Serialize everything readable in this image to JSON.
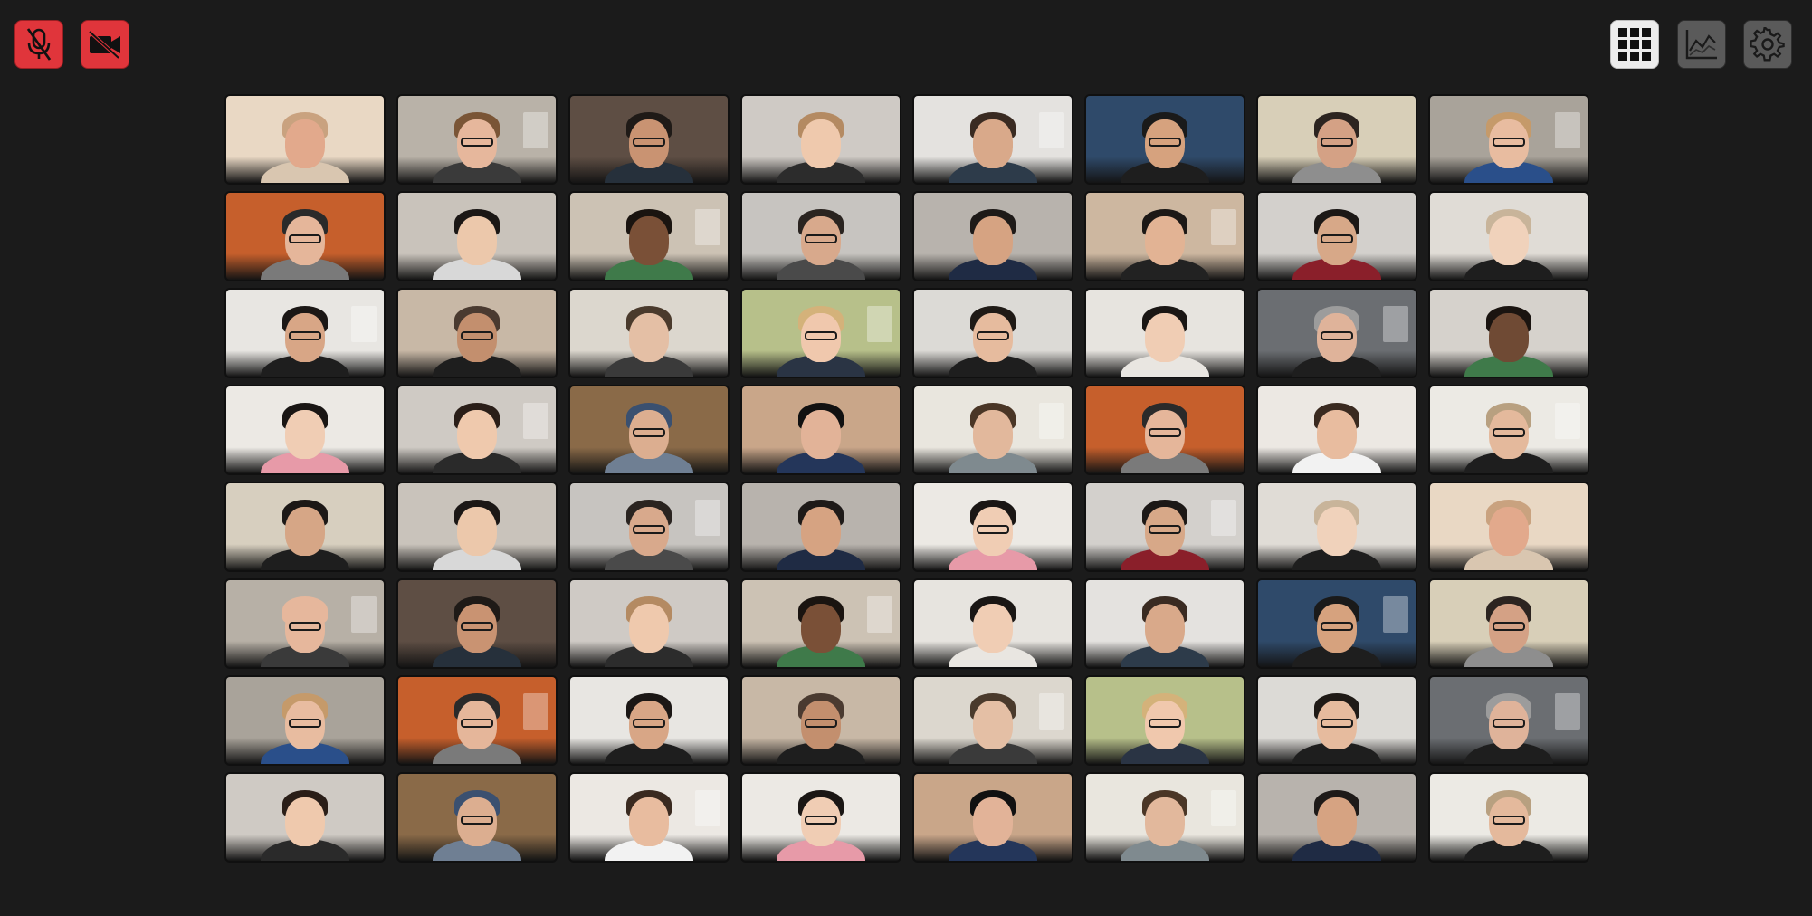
{
  "controls": {
    "mic": {
      "icon": "mic-muted-icon",
      "color": "#e0353b"
    },
    "camera": {
      "icon": "camera-off-icon",
      "color": "#e0353b"
    },
    "layout": {
      "icon": "grid-layout-icon"
    },
    "stats": {
      "icon": "stats-chart-icon"
    },
    "settings": {
      "icon": "gear-icon"
    }
  },
  "participants": [
    {
      "bg": "#e9d8c4",
      "skin": "#e2a98c",
      "hair": "#c9a27f",
      "shirt": "#d9c6b0",
      "glasses": false
    },
    {
      "bg": "#b9b2a8",
      "skin": "#e6b79c",
      "hair": "#7a5536",
      "shirt": "#3a3a3a",
      "glasses": true
    },
    {
      "bg": "#5e4e44",
      "skin": "#c99372",
      "hair": "#1f1a17",
      "shirt": "#26303b",
      "glasses": true
    },
    {
      "bg": "#cfcac5",
      "skin": "#efc9ad",
      "hair": "#b48a62",
      "shirt": "#2c2c2c",
      "glasses": false
    },
    {
      "bg": "#e4e2df",
      "skin": "#d9a98a",
      "hair": "#3a2b22",
      "shirt": "#2d3b4a",
      "glasses": false
    },
    {
      "bg": "#2f4a6a",
      "skin": "#d6a27e",
      "hair": "#1a1a1a",
      "shirt": "#1e1e1e",
      "glasses": true
    },
    {
      "bg": "#d8cfb8",
      "skin": "#d4a185",
      "hair": "#2c2420",
      "shirt": "#8e8e8e",
      "glasses": true
    },
    {
      "bg": "#a9a39a",
      "skin": "#e8bca0",
      "hair": "#c59a6a",
      "shirt": "#2a4f8a",
      "glasses": true
    },
    {
      "bg": "#c65f2c",
      "skin": "#e5b69a",
      "hair": "#2a2a2a",
      "shirt": "#7a7a7a",
      "glasses": true
    },
    {
      "bg": "#c9c3bb",
      "skin": "#ecc8ab",
      "hair": "#1b1715",
      "shirt": "#d8d8d8",
      "glasses": false
    },
    {
      "bg": "#ccc2b4",
      "skin": "#7a5037",
      "hair": "#1a1410",
      "shirt": "#3f7a4a",
      "glasses": false
    },
    {
      "bg": "#c7c4c0",
      "skin": "#d8a98c",
      "hair": "#2a2420",
      "shirt": "#4a4a4a",
      "glasses": true
    },
    {
      "bg": "#b8b3ad",
      "skin": "#d6a382",
      "hair": "#1e1a18",
      "shirt": "#1f2b44",
      "glasses": false
    },
    {
      "bg": "#cdb7a0",
      "skin": "#e2b394",
      "hair": "#1c1816",
      "shirt": "#222222",
      "glasses": false
    },
    {
      "bg": "#d3d0cc",
      "skin": "#d7a888",
      "hair": "#1c1816",
      "shirt": "#8a1f2a",
      "glasses": true
    },
    {
      "bg": "#e0dcd6",
      "skin": "#f0d2bb",
      "hair": "#c8b49a",
      "shirt": "#1e1e1e",
      "glasses": false
    },
    {
      "bg": "#e8e6e2",
      "skin": "#d8a686",
      "hair": "#1b1715",
      "shirt": "#1e1e1e",
      "glasses": true
    },
    {
      "bg": "#c8b8a6",
      "skin": "#c38f6e",
      "hair": "#4a3a30",
      "shirt": "#1e1e1e",
      "glasses": true
    },
    {
      "bg": "#dcd7ce",
      "skin": "#e4bfa5",
      "hair": "#4a3a2c",
      "shirt": "#3a3a3a",
      "glasses": false
    },
    {
      "bg": "#b7c08a",
      "skin": "#f0c8ad",
      "hair": "#d4b27a",
      "shirt": "#2a3444",
      "glasses": true
    },
    {
      "bg": "#dcdad6",
      "skin": "#e6bb9e",
      "hair": "#1f1a16",
      "shirt": "#1e1e1e",
      "glasses": true
    },
    {
      "bg": "#e7e4df",
      "skin": "#f0cdb4",
      "hair": "#1a1614",
      "shirt": "#e9e6e1",
      "glasses": false
    },
    {
      "bg": "#6b6e72",
      "skin": "#dfb39a",
      "hair": "#9c9c9c",
      "shirt": "#1e1e1e",
      "glasses": true
    },
    {
      "bg": "#d6d2cc",
      "skin": "#6f4a34",
      "hair": "#1a1410",
      "shirt": "#3f7a4a",
      "glasses": false
    },
    {
      "bg": "#ece9e4",
      "skin": "#f0cdb4",
      "hair": "#1a1614",
      "shirt": "#e79aa8",
      "glasses": false
    },
    {
      "bg": "#cfcac4",
      "skin": "#efc9ad",
      "hair": "#2a1e18",
      "shirt": "#2a2a2a",
      "glasses": false
    },
    {
      "bg": "#8a6a48",
      "skin": "#dcae90",
      "hair": "#3a5070",
      "shirt": "#6f7f93",
      "glasses": true
    },
    {
      "bg": "#c9a689",
      "skin": "#e2b398",
      "hair": "#111111",
      "shirt": "#24365a",
      "glasses": false
    },
    {
      "bg": "#e9e6de",
      "skin": "#e2b89c",
      "hair": "#4a3626",
      "shirt": "#7f8a8f",
      "glasses": false
    },
    {
      "bg": "#c65f2c",
      "skin": "#e5b69a",
      "hair": "#2a2a2a",
      "shirt": "#7a7a7a",
      "glasses": true
    },
    {
      "bg": "#ece8e3",
      "skin": "#e8bc9f",
      "hair": "#3a2a20",
      "shirt": "#f2f2f2",
      "glasses": false
    },
    {
      "bg": "#eceae4",
      "skin": "#e4b99c",
      "hair": "#b8a080",
      "shirt": "#1e1e1e",
      "glasses": true
    },
    {
      "bg": "#d7cfbf",
      "skin": "#d6a686",
      "hair": "#1c1816",
      "shirt": "#1e1e1e",
      "glasses": false
    },
    {
      "bg": "#c9c3bb",
      "skin": "#ecc8ab",
      "hair": "#1b1715",
      "shirt": "#d8d8d8",
      "glasses": false
    },
    {
      "bg": "#c7c4c0",
      "skin": "#d8a98c",
      "hair": "#2a2420",
      "shirt": "#4a4a4a",
      "glasses": true
    },
    {
      "bg": "#b8b3ad",
      "skin": "#d6a382",
      "hair": "#1e1a18",
      "shirt": "#1f2b44",
      "glasses": false
    },
    {
      "bg": "#ece9e4",
      "skin": "#f0cdb4",
      "hair": "#1a1614",
      "shirt": "#e79aa8",
      "glasses": true
    },
    {
      "bg": "#d3d0cc",
      "skin": "#d7a888",
      "hair": "#1c1816",
      "shirt": "#8a1f2a",
      "glasses": true
    },
    {
      "bg": "#e0dcd6",
      "skin": "#f0d2bb",
      "hair": "#c8b49a",
      "shirt": "#1e1e1e",
      "glasses": false
    },
    {
      "bg": "#e9d8c4",
      "skin": "#e2a98c",
      "hair": "#c9a27f",
      "shirt": "#d9c6b0",
      "glasses": false
    },
    {
      "bg": "#b7b0a6",
      "skin": "#e6b79c",
      "hair": "#e6b79c",
      "shirt": "#3a3a3a",
      "glasses": true
    },
    {
      "bg": "#5e4e44",
      "skin": "#c99372",
      "hair": "#1f1a17",
      "shirt": "#26303b",
      "glasses": true
    },
    {
      "bg": "#cfcac5",
      "skin": "#efc9ad",
      "hair": "#b48a62",
      "shirt": "#2c2c2c",
      "glasses": false
    },
    {
      "bg": "#ccc2b4",
      "skin": "#7a5037",
      "hair": "#1a1410",
      "shirt": "#3f7a4a",
      "glasses": false
    },
    {
      "bg": "#e7e4df",
      "skin": "#f0cdb4",
      "hair": "#1a1614",
      "shirt": "#e9e6e1",
      "glasses": false
    },
    {
      "bg": "#e4e2df",
      "skin": "#d9a98a",
      "hair": "#3a2b22",
      "shirt": "#2d3b4a",
      "glasses": false
    },
    {
      "bg": "#2f4a6a",
      "skin": "#d6a27e",
      "hair": "#1a1a1a",
      "shirt": "#1e1e1e",
      "glasses": true
    },
    {
      "bg": "#d8cfb8",
      "skin": "#d4a185",
      "hair": "#2c2420",
      "shirt": "#8e8e8e",
      "glasses": true
    },
    {
      "bg": "#a9a39a",
      "skin": "#e8bca0",
      "hair": "#c59a6a",
      "shirt": "#2a4f8a",
      "glasses": true
    },
    {
      "bg": "#c65f2c",
      "skin": "#e5b69a",
      "hair": "#2a2a2a",
      "shirt": "#7a7a7a",
      "glasses": true
    },
    {
      "bg": "#e8e6e2",
      "skin": "#d8a686",
      "hair": "#1b1715",
      "shirt": "#1e1e1e",
      "glasses": true
    },
    {
      "bg": "#c8b8a6",
      "skin": "#c38f6e",
      "hair": "#4a3a30",
      "shirt": "#1e1e1e",
      "glasses": true
    },
    {
      "bg": "#dcd7ce",
      "skin": "#e4bfa5",
      "hair": "#4a3a2c",
      "shirt": "#3a3a3a",
      "glasses": false
    },
    {
      "bg": "#b7c08a",
      "skin": "#f0c8ad",
      "hair": "#d4b27a",
      "shirt": "#2a3444",
      "glasses": true
    },
    {
      "bg": "#dcdad6",
      "skin": "#e6bb9e",
      "hair": "#1f1a16",
      "shirt": "#1e1e1e",
      "glasses": true
    },
    {
      "bg": "#6b6e72",
      "skin": "#dfb39a",
      "hair": "#9c9c9c",
      "shirt": "#1e1e1e",
      "glasses": true
    },
    {
      "bg": "#cfcac4",
      "skin": "#efc9ad",
      "hair": "#2a1e18",
      "shirt": "#2a2a2a",
      "glasses": false
    },
    {
      "bg": "#8a6a48",
      "skin": "#dcae90",
      "hair": "#3a5070",
      "shirt": "#6f7f93",
      "glasses": true
    },
    {
      "bg": "#ece8e3",
      "skin": "#e8bc9f",
      "hair": "#3a2a20",
      "shirt": "#f2f2f2",
      "glasses": false
    },
    {
      "bg": "#ece9e4",
      "skin": "#f0cdb4",
      "hair": "#1a1614",
      "shirt": "#e79aa8",
      "glasses": true
    },
    {
      "bg": "#c9a689",
      "skin": "#e2b398",
      "hair": "#111111",
      "shirt": "#24365a",
      "glasses": false
    },
    {
      "bg": "#e9e6de",
      "skin": "#e2b89c",
      "hair": "#4a3626",
      "shirt": "#7f8a8f",
      "glasses": false
    },
    {
      "bg": "#b8b3ad",
      "skin": "#d6a382",
      "hair": "#1e1a18",
      "shirt": "#1f2b44",
      "glasses": false
    },
    {
      "bg": "#eceae4",
      "skin": "#e4b99c",
      "hair": "#b8a080",
      "shirt": "#1e1e1e",
      "glasses": true
    }
  ]
}
